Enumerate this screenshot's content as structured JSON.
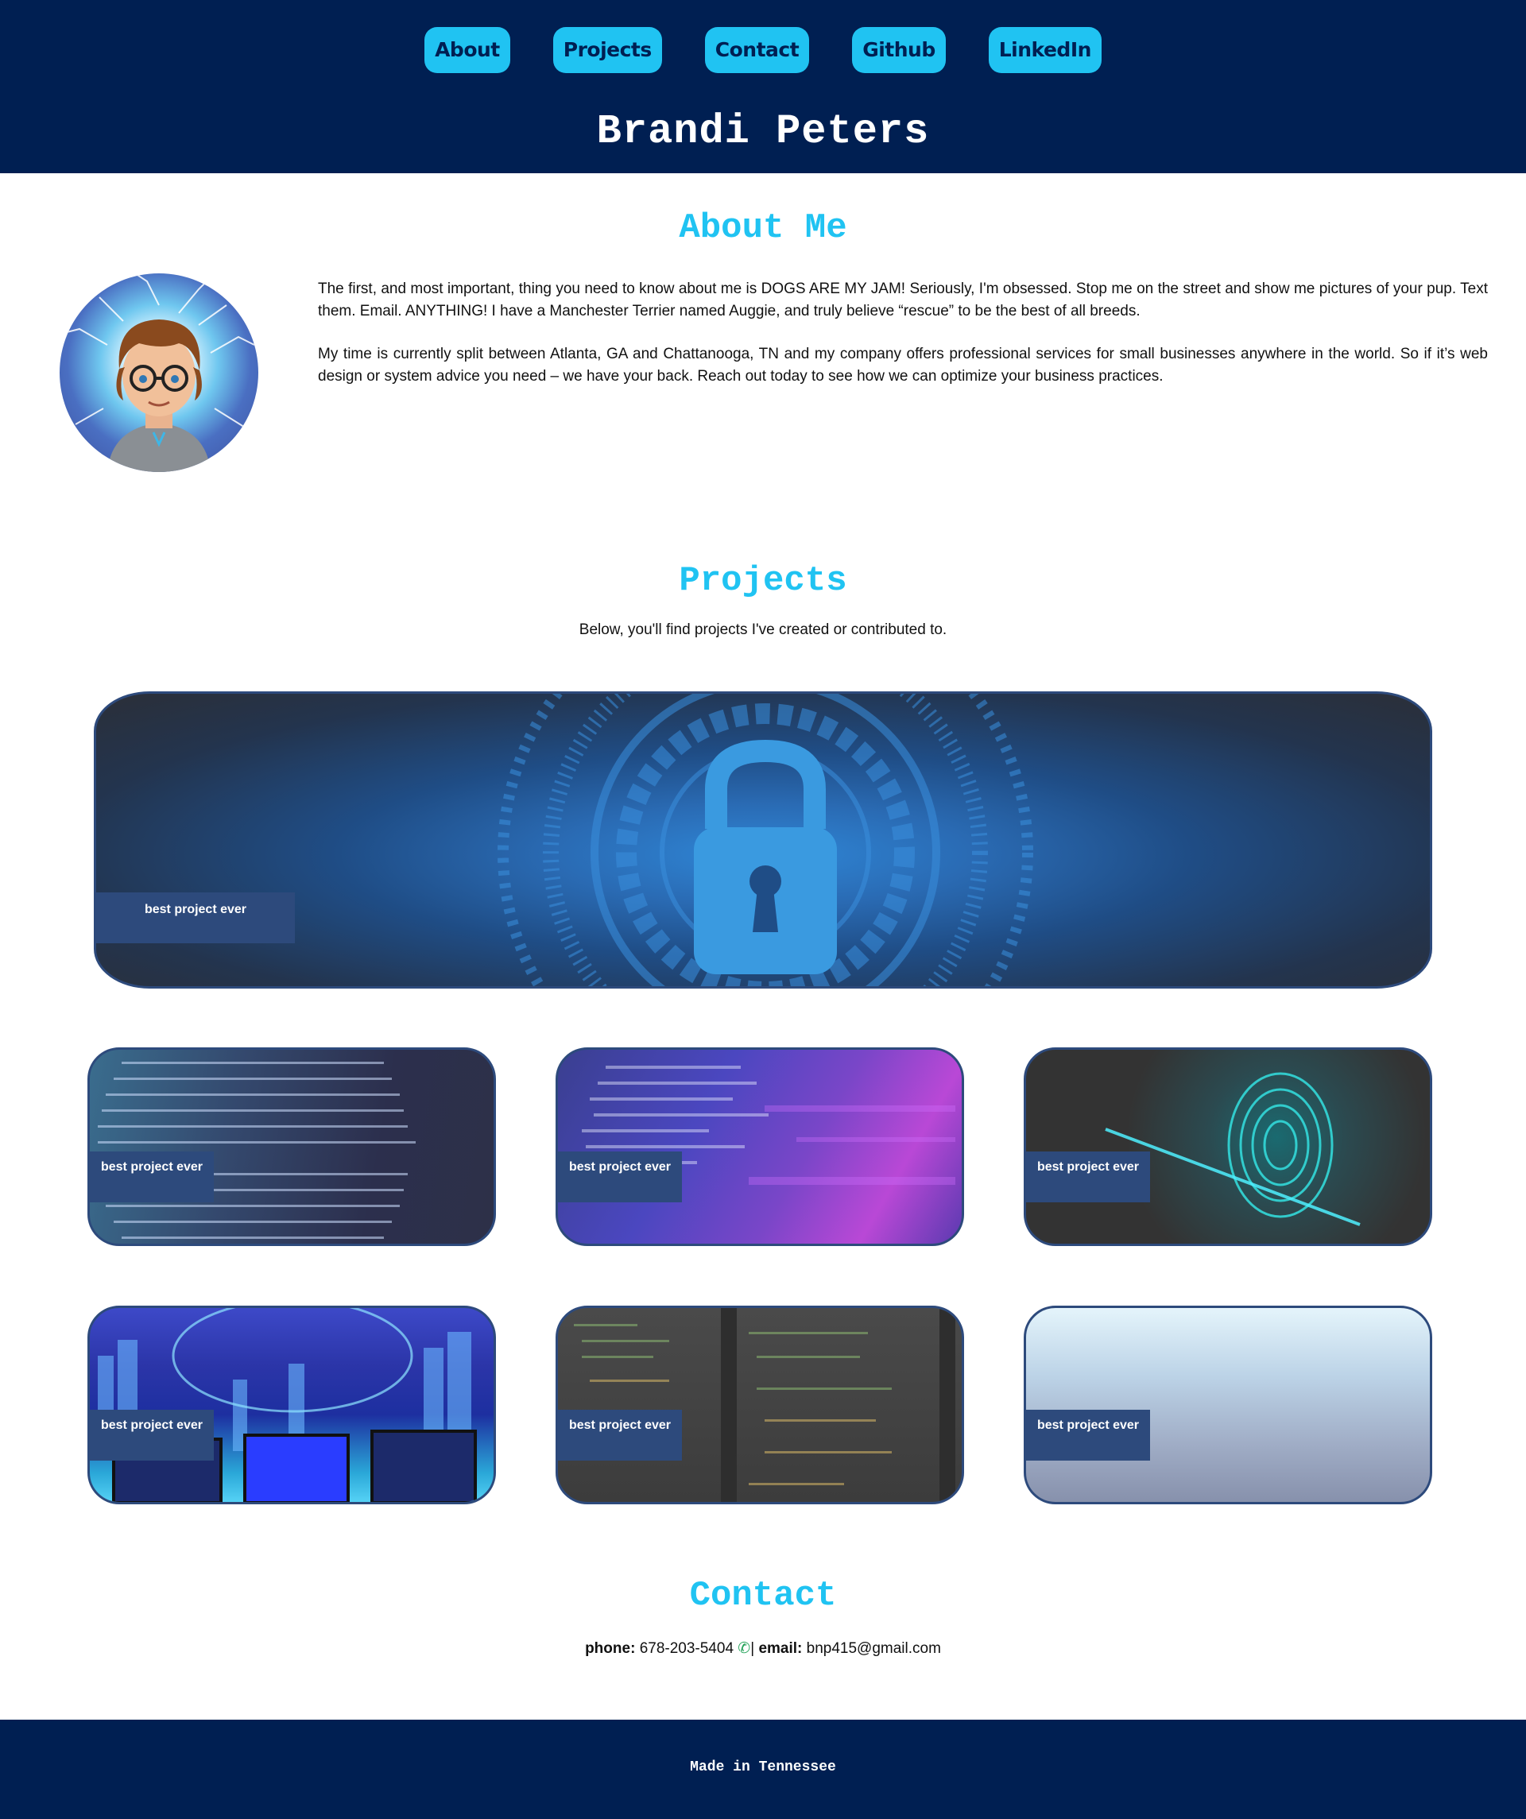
{
  "nav": {
    "items": [
      {
        "label": "About"
      },
      {
        "label": "Projects"
      },
      {
        "label": "Contact"
      },
      {
        "label": "Github"
      },
      {
        "label": "LinkedIn"
      }
    ]
  },
  "header": {
    "title": "Brandi Peters"
  },
  "about": {
    "title": "About Me",
    "avatar_icon": "avatar-cartoon-icon",
    "paragraphs": [
      "The first, and most important, thing you need to know about me is DOGS ARE MY JAM! Seriously, I'm obsessed. Stop me on the street and show me pictures of your pup. Text them. Email. ANYTHING! I have a Manchester Terrier named Auggie, and truly believe “rescue” to be the best of all breeds.",
      "My time is currently split between Atlanta, GA and Chattanooga, TN and my company offers professional services for small businesses anywhere in the world. So if it’s web design or system advice you need – we have your back. Reach out today to see how we can optimize your business practices."
    ]
  },
  "projects": {
    "title": "Projects",
    "subtitle": "Below, you'll find projects I've created or contributed to.",
    "featured": {
      "label": "best project ever",
      "icon": "padlock-icon"
    },
    "cards": [
      {
        "label": "best project ever",
        "theme": "data-stream"
      },
      {
        "label": "best project ever",
        "theme": "code-purple"
      },
      {
        "label": "best project ever",
        "theme": "fingerprint"
      },
      {
        "label": "best project ever",
        "theme": "city-binary"
      },
      {
        "label": "best project ever",
        "theme": "code-dark"
      },
      {
        "label": "best project ever",
        "theme": "sky-gradient"
      }
    ]
  },
  "contact": {
    "title": "Contact",
    "phone_label": "phone:",
    "phone_value": "678-203-5404",
    "phone_icon": "phone-icon",
    "separator": "|",
    "email_label": "email:",
    "email_value": "bnp415@gmail.com"
  },
  "footer": {
    "text": "Made in Tennessee"
  },
  "colors": {
    "navy": "#001f52",
    "accent": "#20c3f2",
    "label_bg": "#2d4a7c"
  }
}
